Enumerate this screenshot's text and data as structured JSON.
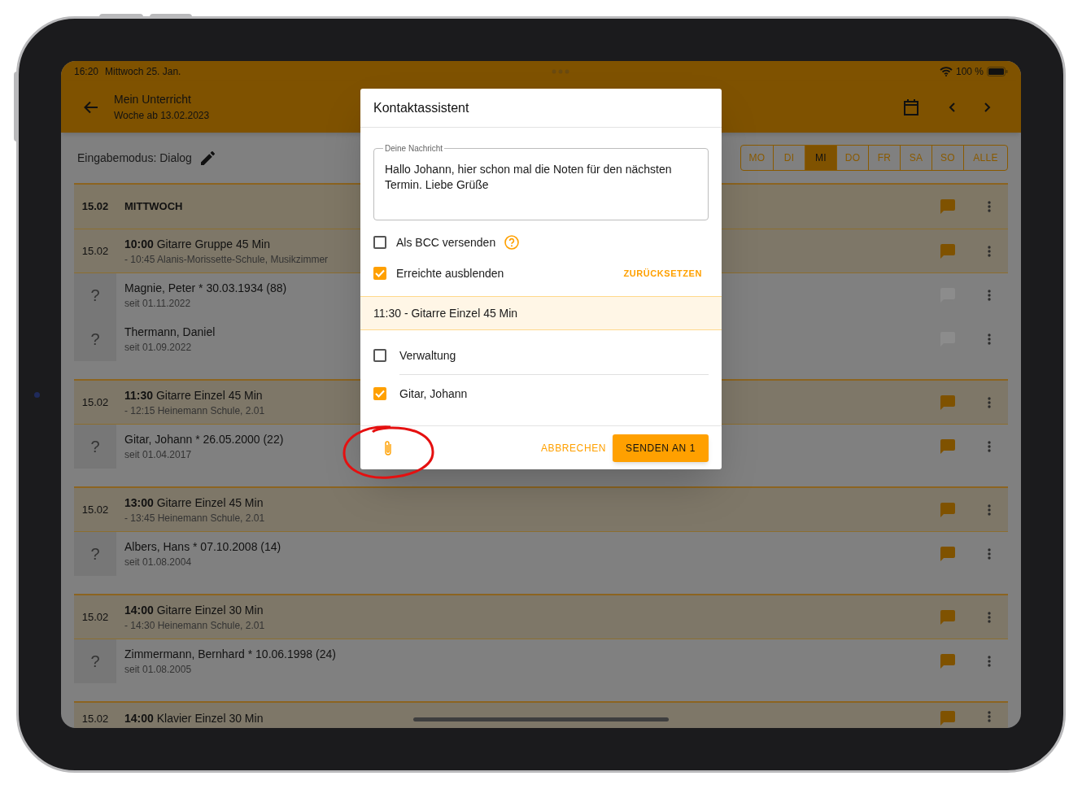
{
  "status_bar": {
    "time": "16:20",
    "date": "Mittwoch 25. Jan.",
    "battery": "100 %"
  },
  "app_bar": {
    "title": "Mein Unterricht",
    "subtitle": "Woche ab 13.02.2023"
  },
  "input_mode": "Eingabemodus: Dialog",
  "day_tabs": [
    {
      "label": "MO",
      "selected": false
    },
    {
      "label": "DI",
      "selected": false
    },
    {
      "label": "MI",
      "selected": true
    },
    {
      "label": "DO",
      "selected": false
    },
    {
      "label": "FR",
      "selected": false
    },
    {
      "label": "SA",
      "selected": false
    },
    {
      "label": "SO",
      "selected": false
    },
    {
      "label": "ALLE",
      "selected": false
    }
  ],
  "sections": [
    {
      "rows": [
        {
          "kind": "day",
          "date": "15.02",
          "title": "MITTWOCH",
          "message_enabled": true
        },
        {
          "kind": "lesson",
          "date": "15.02",
          "title": "**10:00** Gitarre Gruppe 45 Min",
          "detail": "- 10:45 Alanis-Morissette-Schule, Musikzimmer",
          "message_enabled": true
        },
        {
          "kind": "student",
          "mark": "?",
          "name": "Magnie, Peter * 30.03.1934 (88)",
          "since": "seit 01.11.2022",
          "message_enabled": false
        },
        {
          "kind": "student",
          "mark": "?",
          "name": "Thermann, Daniel",
          "since": "seit 01.09.2022",
          "message_enabled": false
        }
      ]
    },
    {
      "rows": [
        {
          "kind": "lesson",
          "date": "15.02",
          "title": "**11:30** Gitarre Einzel 45 Min",
          "detail": "- 12:15 Heinemann Schule, 2.01",
          "message_enabled": true
        },
        {
          "kind": "student",
          "mark": "?",
          "name": "Gitar, Johann * 26.05.2000 (22)",
          "since": "seit 01.04.2017",
          "message_enabled": true
        }
      ]
    },
    {
      "rows": [
        {
          "kind": "lesson",
          "date": "15.02",
          "title": "**13:00** Gitarre Einzel 45 Min",
          "detail": "- 13:45 Heinemann Schule, 2.01",
          "message_enabled": true
        },
        {
          "kind": "student",
          "mark": "?",
          "name": "Albers, Hans * 07.10.2008 (14)",
          "since": "seit 01.08.2004",
          "message_enabled": true
        }
      ]
    },
    {
      "rows": [
        {
          "kind": "lesson",
          "date": "15.02",
          "title": "**14:00** Gitarre Einzel 30 Min",
          "detail": "- 14:30 Heinemann Schule, 2.01",
          "message_enabled": true
        },
        {
          "kind": "student",
          "mark": "?",
          "name": "Zimmermann, Bernhard * 10.06.1998 (24)",
          "since": "seit 01.08.2005",
          "message_enabled": true
        }
      ]
    },
    {
      "rows": [
        {
          "kind": "lesson",
          "date": "15.02",
          "title": "**14:00** Klavier Einzel 30 Min",
          "message_enabled": true
        }
      ]
    }
  ],
  "dialog": {
    "title": "Kontaktassistent",
    "message": {
      "label": "Deine Nachricht",
      "value": "Hallo Johann, hier schon mal die Noten für den nächsten Termin. Liebe Grüße"
    },
    "options": [
      {
        "label": "Als BCC versenden",
        "checked": false,
        "help": true
      },
      {
        "label": "Erreichte ausblenden",
        "checked": true,
        "action": "ZURÜCKSETZEN"
      }
    ],
    "group_header": "11:30 - Gitarre Einzel 45 Min",
    "recipients": [
      {
        "name": "Verwaltung",
        "checked": false
      },
      {
        "name": "Gitar, Johann",
        "checked": true
      }
    ],
    "buttons": [
      {
        "label": "ABBRECHEN",
        "kind": "text"
      },
      {
        "label": "SENDEN AN 1",
        "kind": "contained"
      }
    ]
  }
}
